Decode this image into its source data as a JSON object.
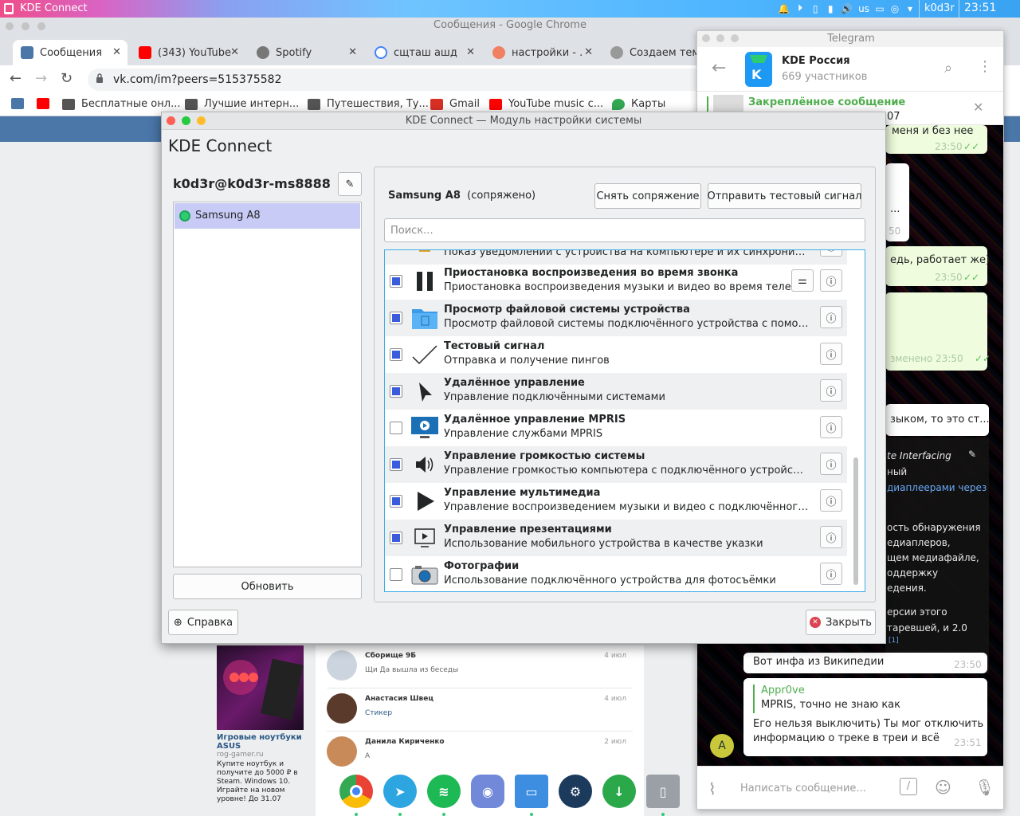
{
  "top_panel": {
    "app_title": "KDE Connect",
    "layout": "us",
    "user": "k0d3r",
    "clock": "23:51"
  },
  "chrome": {
    "window_title": "Сообщения - Google Chrome",
    "tabs": [
      {
        "label": "Сообщения",
        "icon": "vk-messages-icon",
        "color": "#4a76a8"
      },
      {
        "label": "(343) YouTube",
        "icon": "youtube-icon",
        "color": "#ff0000"
      },
      {
        "label": "Spotify",
        "icon": "spotify-icon",
        "color": "#777777"
      },
      {
        "label": "сщташ ашд",
        "icon": "google-icon",
        "color": "#4285f4"
      },
      {
        "label": "настройки - ...",
        "icon": "ask-icon",
        "color": "#f08060"
      },
      {
        "label": "Создаем тем...",
        "icon": "globe-icon",
        "color": "#999999"
      }
    ],
    "url": "vk.com/im?peers=515375582",
    "bookmarks": [
      {
        "label": "",
        "icon": "vk-icon",
        "color": "#4a76a8"
      },
      {
        "label": "",
        "icon": "youtube-icon",
        "color": "#ff0000"
      },
      {
        "label": "Бесплатные онл...",
        "icon": "folder-icon",
        "color": "#555555"
      },
      {
        "label": "Лучшие интерн...",
        "icon": "folder-icon",
        "color": "#555555"
      },
      {
        "label": "Путешествия, Ту...",
        "icon": "folder-icon",
        "color": "#555555"
      },
      {
        "label": "Gmail",
        "icon": "gmail-icon",
        "color": "#d93025"
      },
      {
        "label": "YouTube music c...",
        "icon": "youtube-icon",
        "color": "#ff0000"
      },
      {
        "label": "Карты",
        "icon": "maps-icon",
        "color": "#34a853"
      }
    ]
  },
  "vk": {
    "ad": {
      "title": "Игровые ноутбуки ASUS",
      "domain": "rog-gamer.ru",
      "text": "Купите ноутбук и получите до 5000 ₽ в Steam. Windows 10. Играйте на новом уровне! До 31.07"
    },
    "dialogs": [
      {
        "name": "Сборище 9Б",
        "message": "Щи Да вышла из беседы",
        "date": "4 июл",
        "link": false
      },
      {
        "name": "Анастасия Швец",
        "message": "Стикер",
        "date": "4 июл",
        "link": true
      },
      {
        "name": "Данила Кириченко",
        "message": "А",
        "date": "2 июл",
        "link": false
      }
    ]
  },
  "telegram": {
    "window_title": "Telegram",
    "chat_title": "KDE Россия",
    "chat_subtitle": "669 участников",
    "pinned_label": "Закреплённое сообщение",
    "pinned_num": "07",
    "input_placeholder": "Написать сообщение...",
    "bubbles": [
      {
        "text": "меня и без нее",
        "time": "23:50"
      },
      {
        "text": "...",
        "time": "50"
      },
      {
        "text": "едь, работает же)",
        "time": "23:50"
      },
      {
        "text": "зменено 23:50",
        "time": ""
      },
      {
        "text": "зыком, то это ст...",
        "time": ""
      }
    ],
    "wiki_lines": [
      "te Interfacing",
      "ный",
      "диаплеерами через",
      "ость обнаружения",
      "едиаплеров,",
      "щем медиафайле,",
      "оддержку",
      "едения.",
      "ерсии этого",
      "таревшей, и 2.0",
      "[1]"
    ],
    "msg_wiki": {
      "text": "Вот инфа из Википедии",
      "time": "23:50"
    },
    "msg_reply": {
      "author": "Appr0ve",
      "quote": "MPRIS, точно не знаю как",
      "text1": "Его нельзя выключить) Ты мог отключить",
      "text2": "информацию о треке в треи и всё",
      "time": "23:51"
    }
  },
  "kde": {
    "window_title": "KDE Connect — Модуль настройки системы",
    "heading": "KDE Connect",
    "user": "k0d3r@k0d3r-ms8888",
    "devices": [
      "Samsung A8"
    ],
    "refresh_label": "Обновить",
    "help_label": "Справка",
    "close_label": "Закрыть",
    "device_name": "Samsung A8",
    "device_status": "(сопряжено)",
    "unpair_label": "Снять сопряжение",
    "ping_label": "Отправить тестовый сигнал",
    "search_placeholder": "Поиск...",
    "plugins": [
      {
        "name": "",
        "desc": "Показ уведомлений с устройства на компьютере и их синхронизация",
        "checked": true,
        "icon": "bell-icon",
        "config": false
      },
      {
        "name": "Приостановка воспроизведения во время звонка",
        "desc": "Приостановка воспроизведения музыки и видео во время теле...",
        "checked": true,
        "icon": "pause-icon",
        "config": true
      },
      {
        "name": "Просмотр файловой системы устройства",
        "desc": "Просмотр файловой системы подключённого устройства с помощью ...",
        "checked": true,
        "icon": "folder-icon",
        "config": false
      },
      {
        "name": "Тестовый сигнал",
        "desc": "Отправка и получение пингов",
        "checked": true,
        "icon": "checkmark-icon",
        "config": false
      },
      {
        "name": "Удалённое управление",
        "desc": "Управление подключёнными системами",
        "checked": true,
        "icon": "pointer-icon",
        "config": false
      },
      {
        "name": "Удалённое управление MPRIS",
        "desc": "Управление службами MPRIS",
        "checked": false,
        "icon": "monitor-icon",
        "config": false
      },
      {
        "name": "Управление громкостью системы",
        "desc": "Управление громкостью компьютера с подключённого устройства",
        "checked": true,
        "icon": "speaker-icon",
        "config": false
      },
      {
        "name": "Управление мультимедиа",
        "desc": "Управление воспроизведением музыки и видео с подключённого уст...",
        "checked": true,
        "icon": "play-icon",
        "config": false
      },
      {
        "name": "Управление презентациями",
        "desc": "Использование мобильного устройства в качестве указки",
        "checked": true,
        "icon": "presentation-icon",
        "config": false
      },
      {
        "name": "Фотографии",
        "desc": "Использование подключённого устройства для фотосъёмки",
        "checked": false,
        "icon": "camera-icon",
        "config": false
      }
    ]
  }
}
